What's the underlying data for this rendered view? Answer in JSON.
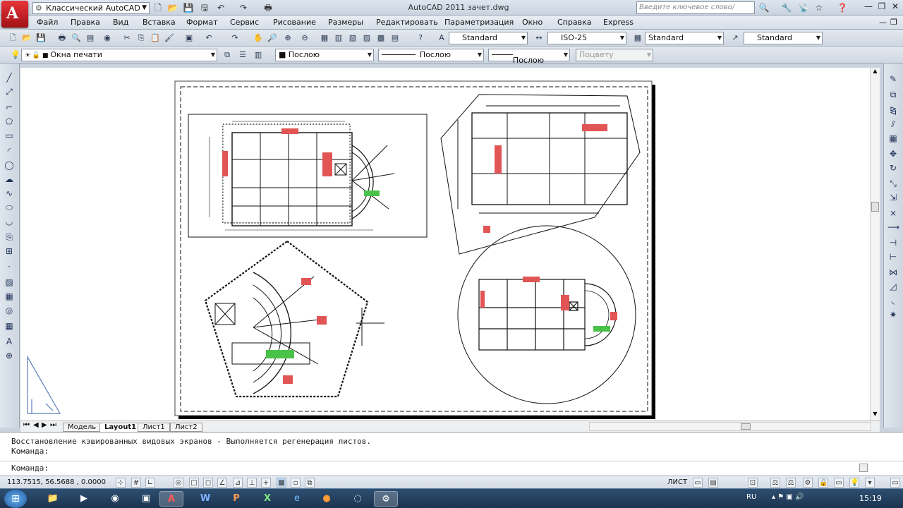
{
  "app": {
    "workspace": "Классический AutoCAD",
    "title": "AutoCAD 2011    зачет.dwg",
    "search_placeholder": "Введите ключевое слово/фразу"
  },
  "menu": [
    "Файл",
    "Правка",
    "Вид",
    "Вставка",
    "Формат",
    "Сервис",
    "Рисование",
    "Размеры",
    "Редактировать",
    "Параметризация",
    "Окно",
    "Справка",
    "Express"
  ],
  "styles": {
    "text_style": "Standard",
    "dim_style": "ISO-25",
    "table_style": "Standard",
    "mleader_style": "Standard"
  },
  "layers": {
    "layer": "Окна печати",
    "color": "Послою",
    "linetype": "Послою",
    "lineweight": "Послою",
    "plotstyle": "Поцвету"
  },
  "tabs": [
    "Модель",
    "Layout1",
    "Лист1",
    "Лист2"
  ],
  "active_tab": "Layout1",
  "command": {
    "history_line": "Восстановление кэшированных видовых экранов - Выполняется регенерация листов.",
    "prompt1": "Команда:",
    "prompt2": "Команда:"
  },
  "status": {
    "coords": "113.7515, 56.5688 , 0.0000",
    "space": "ЛИСТ"
  },
  "taskbar": {
    "lang": "RU",
    "time": "15:19"
  },
  "colors": {
    "accent_red": "#c8102e",
    "hatch_red": "#d94040",
    "hatch_green": "#2bb52b"
  }
}
